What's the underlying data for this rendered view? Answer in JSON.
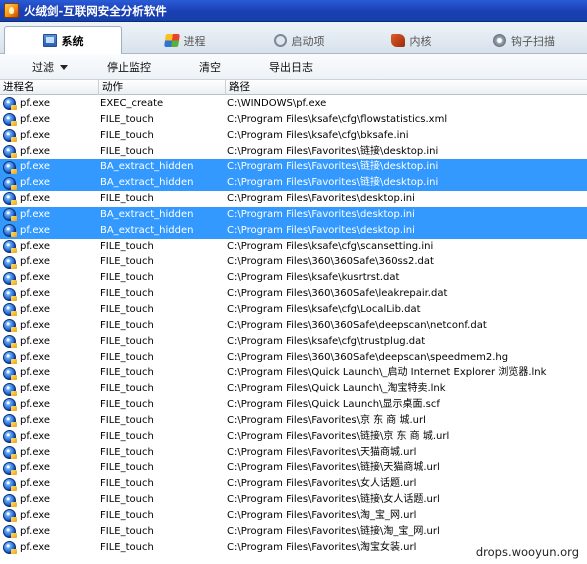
{
  "window": {
    "title": "火绒剑-互联网安全分析软件"
  },
  "tabs": [
    {
      "label": "系统",
      "icon": "system-icon",
      "active": true
    },
    {
      "label": "进程",
      "icon": "process-icon",
      "active": false
    },
    {
      "label": "启动项",
      "icon": "startup-icon",
      "active": false
    },
    {
      "label": "内核",
      "icon": "kernel-icon",
      "active": false
    },
    {
      "label": "钩子扫描",
      "icon": "hook-scan-icon",
      "active": false
    }
  ],
  "toolbar": {
    "filter_label": "过滤",
    "stop_label": "停止监控",
    "clear_label": "清空",
    "export_label": "导出日志"
  },
  "columns": {
    "process": "进程名",
    "action": "动作",
    "path": "路径"
  },
  "rows": [
    {
      "process": "pf.exe",
      "action": "EXEC_create",
      "path": "C:\\WINDOWS\\pf.exe",
      "selected": false
    },
    {
      "process": "pf.exe",
      "action": "FILE_touch",
      "path": "C:\\Program Files\\ksafe\\cfg\\flowstatistics.xml",
      "selected": false
    },
    {
      "process": "pf.exe",
      "action": "FILE_touch",
      "path": "C:\\Program Files\\ksafe\\cfg\\bksafe.ini",
      "selected": false
    },
    {
      "process": "pf.exe",
      "action": "FILE_touch",
      "path": "C:\\Program Files\\Favorites\\链接\\desktop.ini",
      "selected": false
    },
    {
      "process": "pf.exe",
      "action": "BA_extract_hidden",
      "path": "C:\\Program Files\\Favorites\\链接\\desktop.ini",
      "selected": true
    },
    {
      "process": "pf.exe",
      "action": "BA_extract_hidden",
      "path": "C:\\Program Files\\Favorites\\链接\\desktop.ini",
      "selected": true
    },
    {
      "process": "pf.exe",
      "action": "FILE_touch",
      "path": "C:\\Program Files\\Favorites\\desktop.ini",
      "selected": false
    },
    {
      "process": "pf.exe",
      "action": "BA_extract_hidden",
      "path": "C:\\Program Files\\Favorites\\desktop.ini",
      "selected": true
    },
    {
      "process": "pf.exe",
      "action": "BA_extract_hidden",
      "path": "C:\\Program Files\\Favorites\\desktop.ini",
      "selected": true
    },
    {
      "process": "pf.exe",
      "action": "FILE_touch",
      "path": "C:\\Program Files\\ksafe\\cfg\\scansetting.ini",
      "selected": false
    },
    {
      "process": "pf.exe",
      "action": "FILE_touch",
      "path": "C:\\Program Files\\360\\360Safe\\360ss2.dat",
      "selected": false
    },
    {
      "process": "pf.exe",
      "action": "FILE_touch",
      "path": "C:\\Program Files\\ksafe\\kusrtrst.dat",
      "selected": false
    },
    {
      "process": "pf.exe",
      "action": "FILE_touch",
      "path": "C:\\Program Files\\360\\360Safe\\leakrepair.dat",
      "selected": false
    },
    {
      "process": "pf.exe",
      "action": "FILE_touch",
      "path": "C:\\Program Files\\ksafe\\cfg\\LocalLib.dat",
      "selected": false
    },
    {
      "process": "pf.exe",
      "action": "FILE_touch",
      "path": "C:\\Program Files\\360\\360Safe\\deepscan\\netconf.dat",
      "selected": false
    },
    {
      "process": "pf.exe",
      "action": "FILE_touch",
      "path": "C:\\Program Files\\ksafe\\cfg\\trustplug.dat",
      "selected": false
    },
    {
      "process": "pf.exe",
      "action": "FILE_touch",
      "path": "C:\\Program Files\\360\\360Safe\\deepscan\\speedmem2.hg",
      "selected": false
    },
    {
      "process": "pf.exe",
      "action": "FILE_touch",
      "path": "C:\\Program Files\\Quick Launch\\_启动 Internet Explorer 浏览器.lnk",
      "selected": false
    },
    {
      "process": "pf.exe",
      "action": "FILE_touch",
      "path": "C:\\Program Files\\Quick Launch\\_淘宝特卖.lnk",
      "selected": false
    },
    {
      "process": "pf.exe",
      "action": "FILE_touch",
      "path": "C:\\Program Files\\Quick Launch\\显示桌面.scf",
      "selected": false
    },
    {
      "process": "pf.exe",
      "action": "FILE_touch",
      "path": "C:\\Program Files\\Favorites\\京 东 商 城.url",
      "selected": false
    },
    {
      "process": "pf.exe",
      "action": "FILE_touch",
      "path": "C:\\Program Files\\Favorites\\链接\\京 东 商 城.url",
      "selected": false
    },
    {
      "process": "pf.exe",
      "action": "FILE_touch",
      "path": "C:\\Program Files\\Favorites\\天猫商城.url",
      "selected": false
    },
    {
      "process": "pf.exe",
      "action": "FILE_touch",
      "path": "C:\\Program Files\\Favorites\\链接\\天猫商城.url",
      "selected": false
    },
    {
      "process": "pf.exe",
      "action": "FILE_touch",
      "path": "C:\\Program Files\\Favorites\\女人话题.url",
      "selected": false
    },
    {
      "process": "pf.exe",
      "action": "FILE_touch",
      "path": "C:\\Program Files\\Favorites\\链接\\女人话题.url",
      "selected": false
    },
    {
      "process": "pf.exe",
      "action": "FILE_touch",
      "path": "C:\\Program Files\\Favorites\\淘_宝_网.url",
      "selected": false
    },
    {
      "process": "pf.exe",
      "action": "FILE_touch",
      "path": "C:\\Program Files\\Favorites\\链接\\淘_宝_网.url",
      "selected": false
    },
    {
      "process": "pf.exe",
      "action": "FILE_touch",
      "path": "C:\\Program Files\\Favorites\\淘宝女装.url",
      "selected": false
    }
  ],
  "watermark": "drops.wooyun.org",
  "colors": {
    "selection": "#3399ff",
    "titlebar": "#1a3fb4"
  }
}
